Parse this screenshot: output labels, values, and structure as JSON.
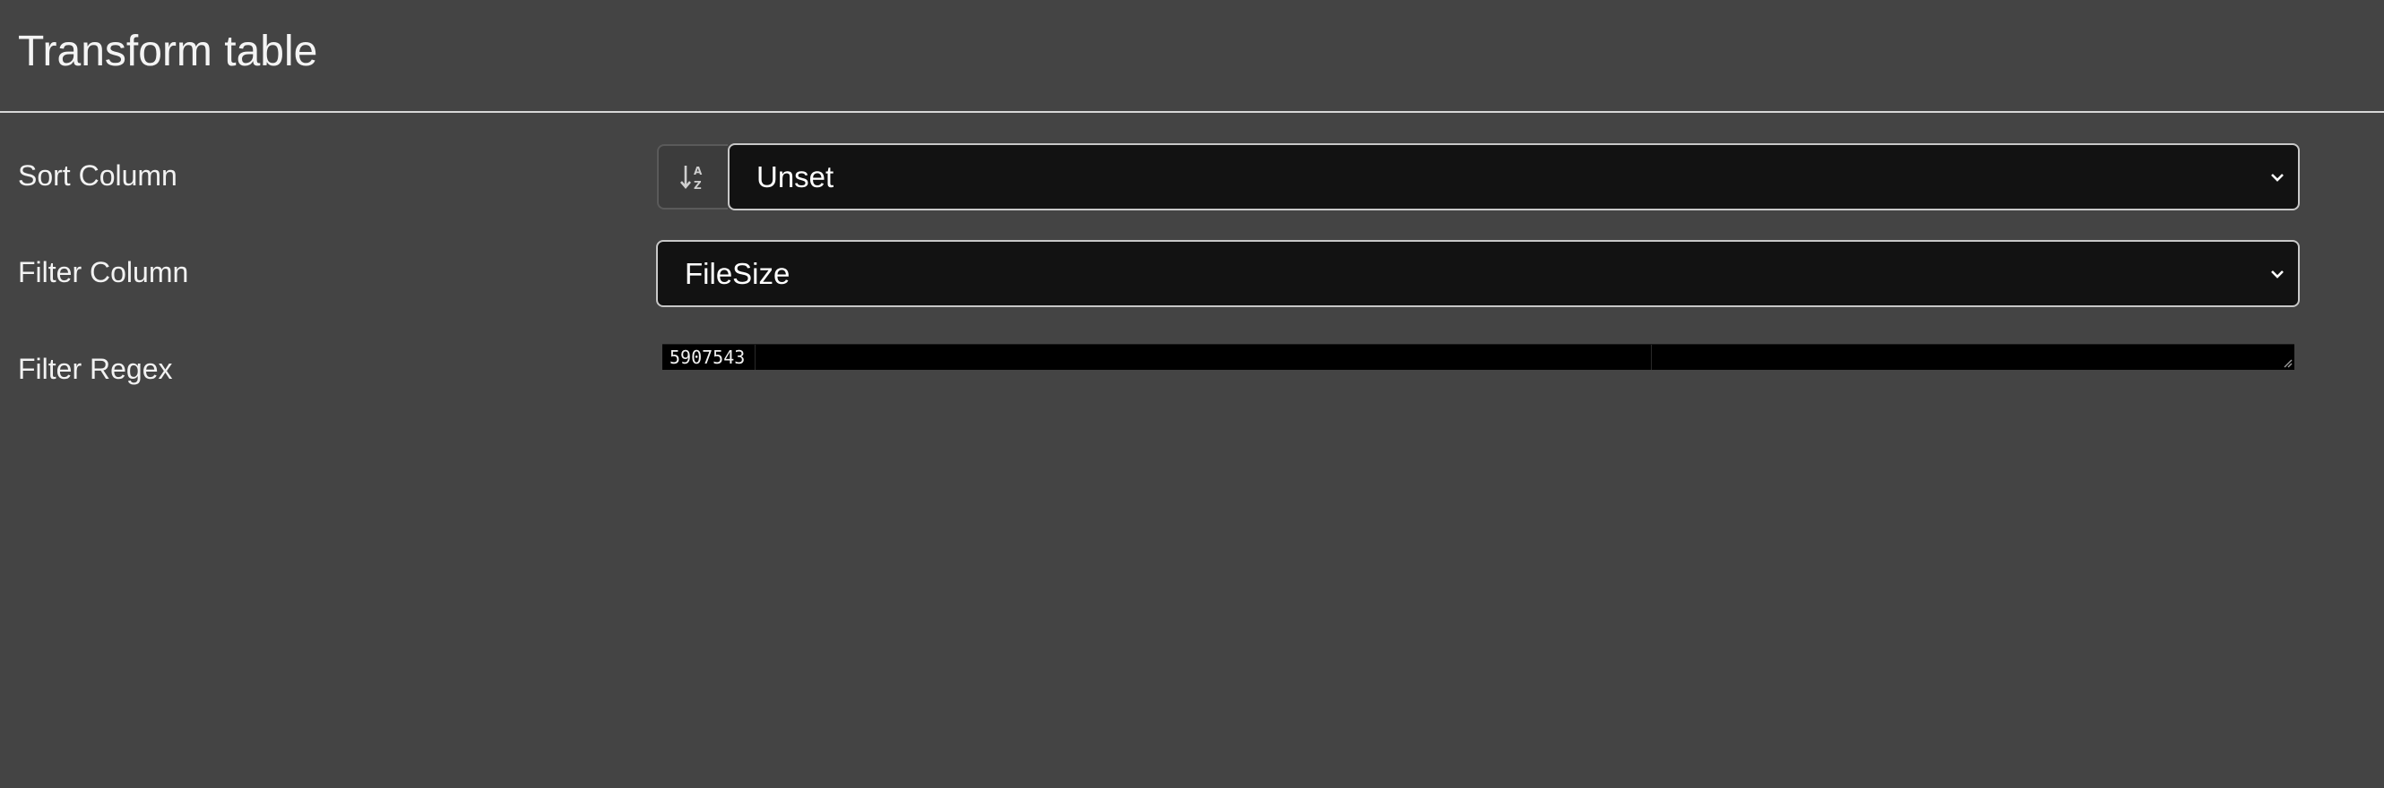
{
  "panel": {
    "title": "Transform table"
  },
  "sort": {
    "label": "Sort Column",
    "button_icon": "sort-alpha-down-icon",
    "selected": "Unset"
  },
  "filter": {
    "label": "Filter Column",
    "selected": "FileSize"
  },
  "regex": {
    "label": "Filter Regex",
    "value": "5907543"
  }
}
